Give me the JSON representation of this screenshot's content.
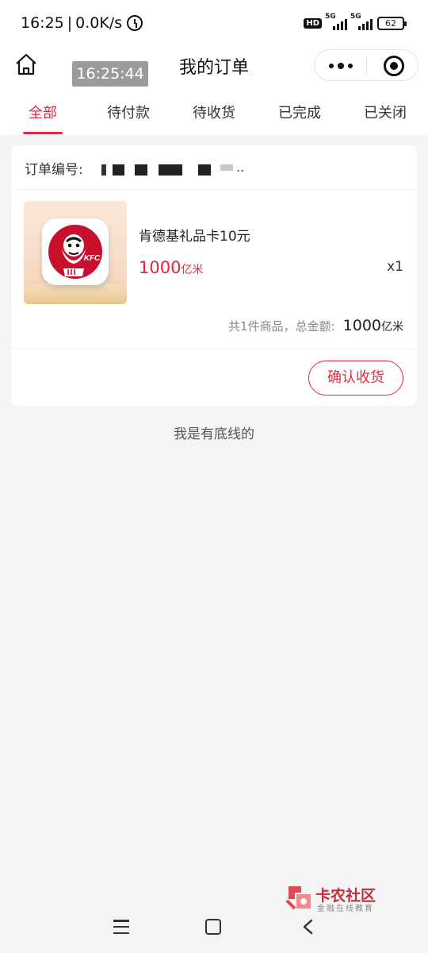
{
  "status_bar": {
    "time": "16:25",
    "speed": "0.0K/s",
    "hd_label": "HD",
    "network_1": "5G",
    "network_2": "5G",
    "battery": "62"
  },
  "header": {
    "time_overlay": "16:25:44",
    "title": "我的订单"
  },
  "tabs": [
    {
      "label": "全部",
      "active": true
    },
    {
      "label": "待付款",
      "active": false
    },
    {
      "label": "待收货",
      "active": false
    },
    {
      "label": "已完成",
      "active": false
    },
    {
      "label": "已关闭",
      "active": false
    }
  ],
  "order": {
    "order_no_label": "订单编号:",
    "order_no_ellipsis": "..",
    "product": {
      "name": "肯德基礼品卡10元",
      "price": "1000",
      "price_unit": "亿米",
      "quantity": "x1",
      "logo_text": "KFC"
    },
    "summary_label": "共1件商品，总金额:",
    "total": "1000",
    "total_unit": "亿米",
    "confirm_label": "确认收货"
  },
  "bottom_line": "我是有底线的",
  "watermark": {
    "title": "卡农社区",
    "subtitle": "金融在线教育"
  },
  "colors": {
    "accent": "#e8273a",
    "background": "#f4f4f4"
  }
}
